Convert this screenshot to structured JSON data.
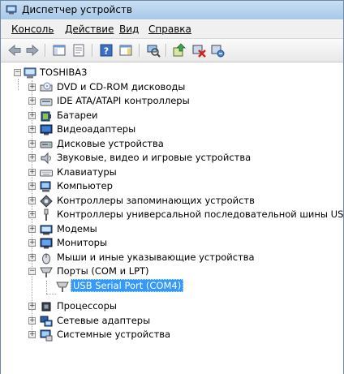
{
  "window": {
    "title": "Диспетчер устройств"
  },
  "menu": {
    "items": [
      "Консоль",
      "Действие",
      "Вид",
      "Справка"
    ]
  },
  "tree": {
    "root": "TOSHIBA3",
    "items": [
      {
        "label": "DVD и CD-ROM дисководы",
        "icon": "dvd-drive-icon"
      },
      {
        "label": "IDE ATA/ATAPI контроллеры",
        "icon": "ide-controller-icon"
      },
      {
        "label": "Батареи",
        "icon": "battery-icon"
      },
      {
        "label": "Видеоадаптеры",
        "icon": "display-adapter-icon"
      },
      {
        "label": "Дисковые устройства",
        "icon": "disk-drive-icon"
      },
      {
        "label": "Звуковые, видео и игровые устройства",
        "icon": "speaker-icon"
      },
      {
        "label": "Клавиатуры",
        "icon": "keyboard-icon"
      },
      {
        "label": "Компьютер",
        "icon": "computer-icon"
      },
      {
        "label": "Контроллеры запоминающих устройств",
        "icon": "storage-controller-icon"
      },
      {
        "label": "Контроллеры универсальной последовательной шины USB",
        "icon": "usb-icon"
      },
      {
        "label": "Модемы",
        "icon": "modem-icon"
      },
      {
        "label": "Мониторы",
        "icon": "monitor-icon"
      },
      {
        "label": "Мыши и иные указывающие устройства",
        "icon": "mouse-icon"
      },
      {
        "label": "Порты (COM и LPT)",
        "icon": "port-icon"
      },
      {
        "label": "USB Serial Port (COM4)",
        "icon": "port-icon"
      },
      {
        "label": "Процессоры",
        "icon": "processor-icon"
      },
      {
        "label": "Сетевые адаптеры",
        "icon": "network-adapter-icon"
      },
      {
        "label": "Системные устройства",
        "icon": "system-devices-icon"
      }
    ]
  }
}
